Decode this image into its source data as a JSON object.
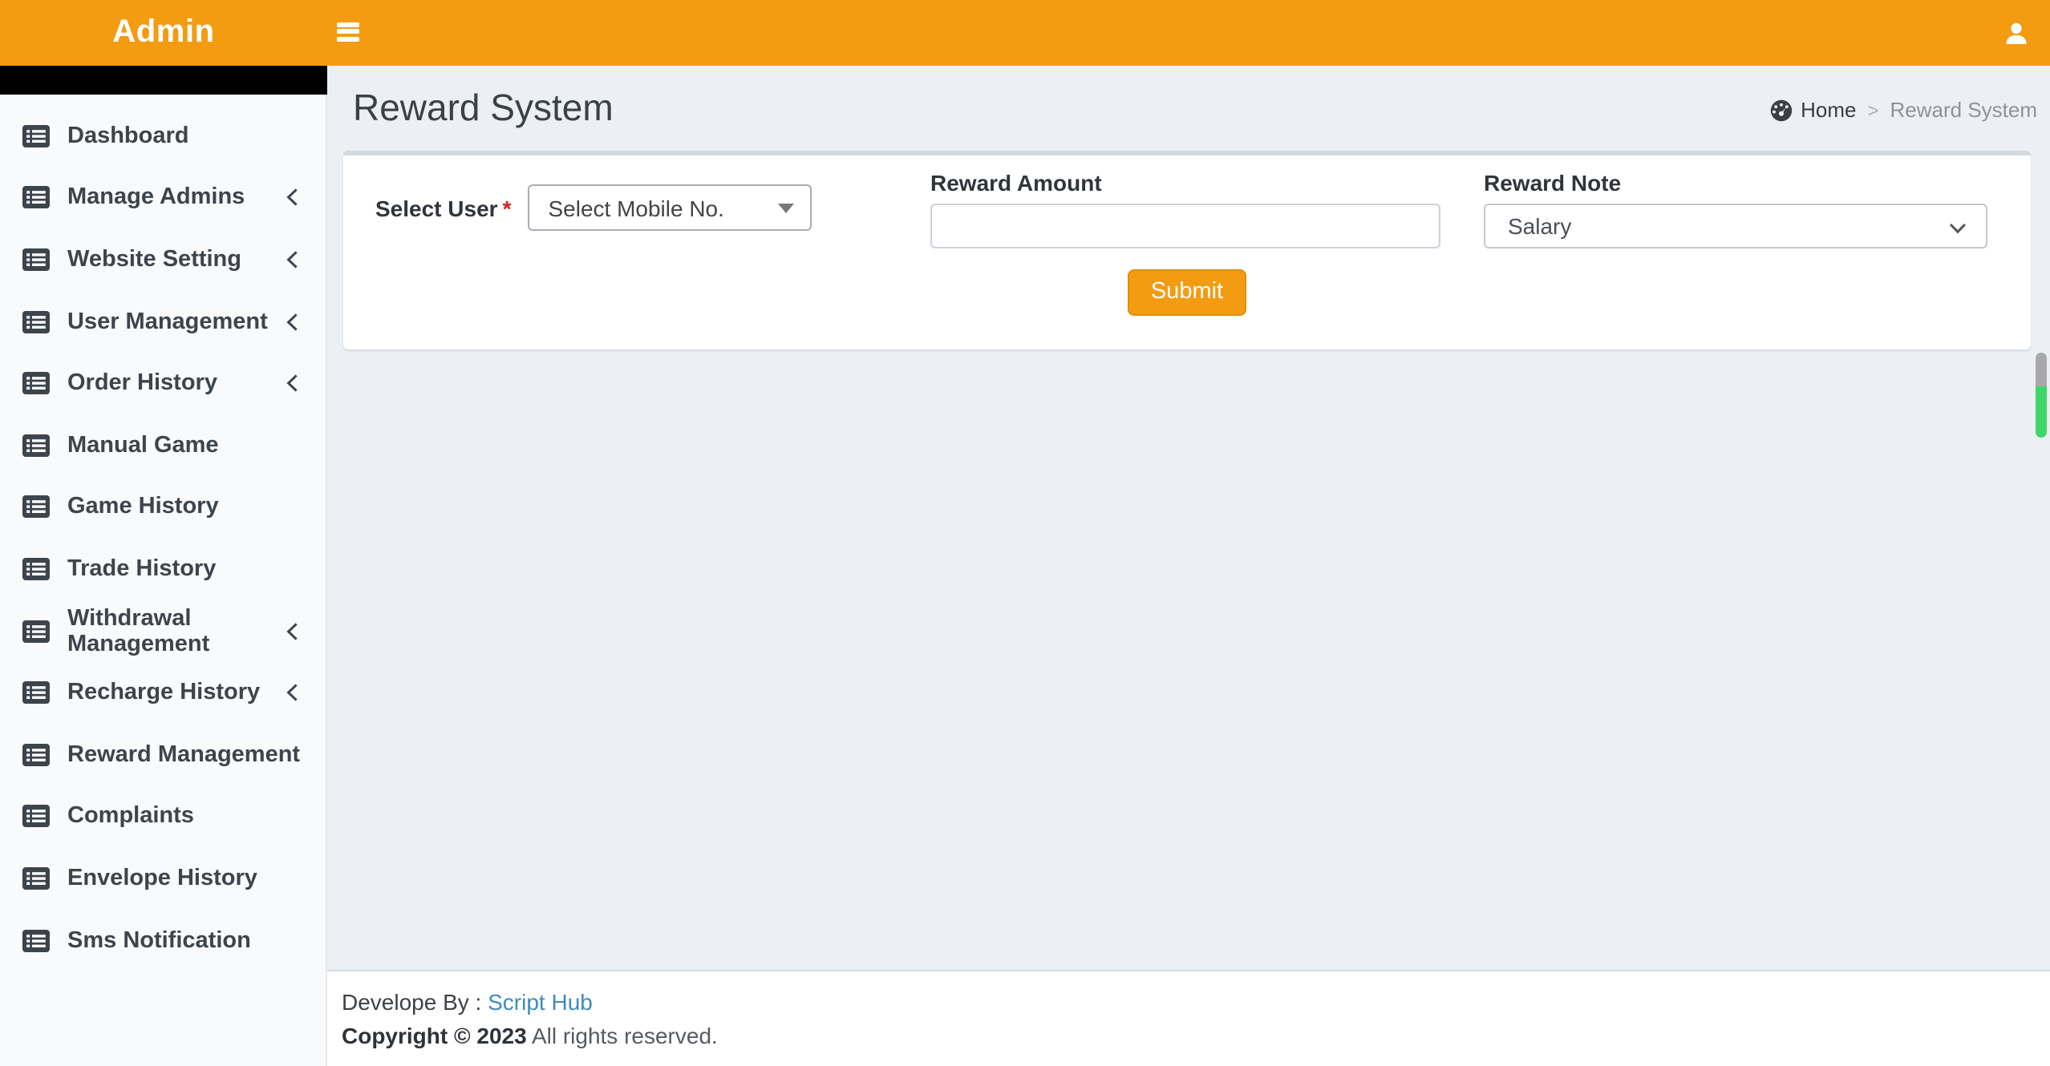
{
  "topbar": {
    "brand": "Admin",
    "accent_color": "#f39c12",
    "icons": {
      "menu": "hamburger-icon",
      "account": "user-icon"
    }
  },
  "sidebar": {
    "items": [
      {
        "label": "Dashboard",
        "icon": "list-alt-icon",
        "has_submenu": false
      },
      {
        "label": "Manage Admins",
        "icon": "list-alt-icon",
        "has_submenu": true
      },
      {
        "label": "Website Setting",
        "icon": "list-alt-icon",
        "has_submenu": true
      },
      {
        "label": "User Management",
        "icon": "list-alt-icon",
        "has_submenu": true
      },
      {
        "label": "Order History",
        "icon": "list-alt-icon",
        "has_submenu": true
      },
      {
        "label": "Manual Game",
        "icon": "list-alt-icon",
        "has_submenu": false
      },
      {
        "label": "Game History",
        "icon": "list-alt-icon",
        "has_submenu": false
      },
      {
        "label": "Trade History",
        "icon": "list-alt-icon",
        "has_submenu": false
      },
      {
        "label": "Withdrawal Management",
        "icon": "list-alt-icon",
        "has_submenu": true
      },
      {
        "label": "Recharge History",
        "icon": "list-alt-icon",
        "has_submenu": true
      },
      {
        "label": "Reward Management",
        "icon": "list-alt-icon",
        "has_submenu": false
      },
      {
        "label": "Complaints",
        "icon": "list-alt-icon",
        "has_submenu": false
      },
      {
        "label": "Envelope History",
        "icon": "list-alt-icon",
        "has_submenu": false
      },
      {
        "label": "Sms Notification",
        "icon": "list-alt-icon",
        "has_submenu": false
      }
    ]
  },
  "page": {
    "title": "Reward System",
    "breadcrumb": {
      "icon": "dashboard-icon",
      "home": "Home",
      "separator": ">",
      "current": "Reward System"
    }
  },
  "form": {
    "select_user": {
      "label": "Select User",
      "required_mark": "*",
      "required_color": "#dd1c1c",
      "selected_text": "Select Mobile No."
    },
    "reward_amount": {
      "label": "Reward Amount",
      "value": ""
    },
    "reward_note": {
      "label": "Reward Note",
      "value": "Salary"
    },
    "submit_label": "Submit"
  },
  "footer": {
    "developed_by": "Develope By :",
    "developer_link": "Script Hub",
    "link_color": "#3c8dbc",
    "copyright_bold": "Copyright © 2023",
    "copyright_rest": "All rights reserved."
  },
  "scroll_indicator": {
    "top_color": "#a8a8a8",
    "bottom_color": "#3fd767"
  }
}
